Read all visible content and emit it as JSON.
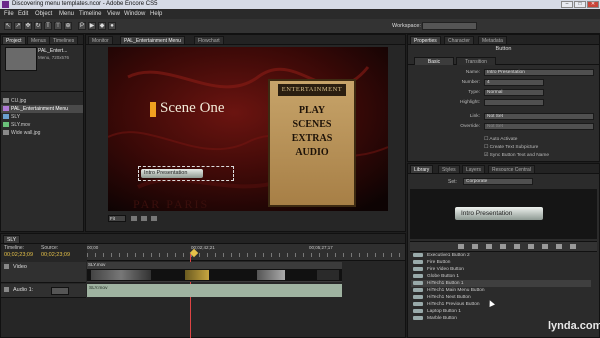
{
  "window": {
    "title": "Discovering menu templates.ncor - Adobe Encore CS5",
    "controls": [
      "–",
      "□",
      "✕"
    ]
  },
  "menubar": [
    "File",
    "Edit",
    "Object",
    "Menu",
    "Timeline",
    "View",
    "Window",
    "Help"
  ],
  "workspace": {
    "label": "Workspace:",
    "value": ""
  },
  "project": {
    "tabs": [
      "Project",
      "Menus",
      "Timelines"
    ],
    "preview": {
      "name": "PAL_Entert...",
      "desc": "Menu, 720x576"
    },
    "items": [
      "CU.jpg",
      "PAL_Entertainment Menu",
      "SLY",
      "SLY.mov",
      "Wide wall.jpg"
    ]
  },
  "monitor": {
    "tabs": [
      "Monitor",
      "PAL_Entertainment Menu",
      "Flowchart"
    ],
    "scene_text": "Scene One",
    "button_text": "Intro Presentation",
    "sign_title": "ENTERTAINMENT",
    "menu_items": [
      "PLAY",
      "SCENES",
      "EXTRAS",
      "AUDIO"
    ],
    "watermark": "PAR PARIS",
    "zoom": "Fit"
  },
  "properties": {
    "tabs": [
      "Properties",
      "Character",
      "Metadata"
    ],
    "heading": "Button",
    "subtabs": [
      "Basic",
      "Transition"
    ],
    "fields": [
      {
        "label": "Name:",
        "value": "Intro Presentation"
      },
      {
        "label": "Number:",
        "value": "4"
      },
      {
        "label": "Type:",
        "value": "Normal"
      },
      {
        "label": "Highlight:",
        "value": ""
      },
      {
        "label": "Link:",
        "value": "Not Set"
      },
      {
        "label": "Override:",
        "value": "Not Set"
      }
    ],
    "checkboxes": [
      "Auto Activate",
      "Create Text Subpicture",
      "Sync Button Text and Name"
    ]
  },
  "library": {
    "tabs": [
      "Library",
      "Styles",
      "Layers",
      "Resource Central"
    ],
    "set_label": "Set:",
    "set_value": "Corporate",
    "preview_button": "Intro Presentation",
    "items": [
      "Executive1 Button 2",
      "Fire Button",
      "Fire Video Button",
      "Globe Button 1",
      "HiTech1 Button 1",
      "HiTech1 Main Menu Button",
      "HiTech1 Next Button",
      "HiTech1 Previous Button",
      "Laptop Button 1",
      "Marble Button"
    ]
  },
  "timeline": {
    "tab": "SLY",
    "timeline_label": "Timeline:",
    "source_label": "Source:",
    "timeline_tc": "00;02;23;09",
    "source_tc": "00;02;23;09",
    "ruler": [
      "00;00",
      "00;02;42;21",
      "00;05;27;17"
    ],
    "video_label": "Video",
    "clip_label": "SLY.mov",
    "audio_label": "Audio 1:",
    "audio_clip": "SLY.mov"
  },
  "watermark": "lynda.com"
}
